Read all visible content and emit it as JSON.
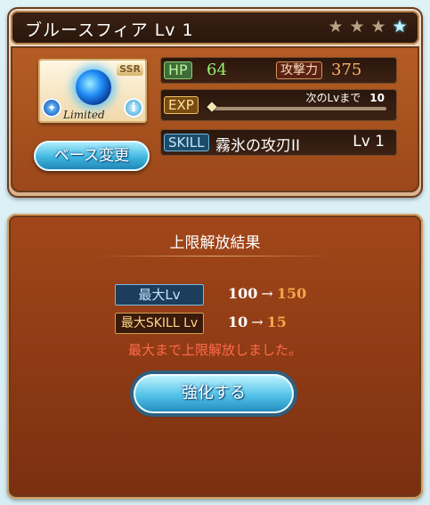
{
  "header": {
    "title": "ブルースフィア Lv 1",
    "stars": [
      "star-brown",
      "star-brown",
      "star-brown",
      "star-blue"
    ]
  },
  "card": {
    "rarity": "SSR",
    "label": "Limited",
    "element_icon": "water-element-icon",
    "info_icon": "info-icon"
  },
  "base_button": {
    "label": "ベース変更"
  },
  "stats": {
    "hp_label": "HP",
    "hp_value": "64",
    "atk_label": "攻撃力",
    "atk_value": "375",
    "exp_label": "EXP",
    "exp_next_label": "次のLvまで",
    "exp_next_value": "10",
    "exp_progress": 0.0,
    "skill_label": "SKILL",
    "skill_name": "霧氷の攻刃II",
    "skill_level": "Lv 1"
  },
  "result": {
    "title": "上限解放結果",
    "max_lv_label": "最大Lv",
    "max_lv_old": "100",
    "max_lv_new": "150",
    "max_skill_label": "最大SKILL Lv",
    "max_skill_old": "10",
    "max_skill_new": "15",
    "arrow": "→",
    "message": "最大まで上限解放しました。",
    "enhance_button": "強化する"
  },
  "colors": {
    "accent_blue": "#52c2e8",
    "new_value_orange": "#f5a44a",
    "message_red": "#ff6a4a"
  }
}
